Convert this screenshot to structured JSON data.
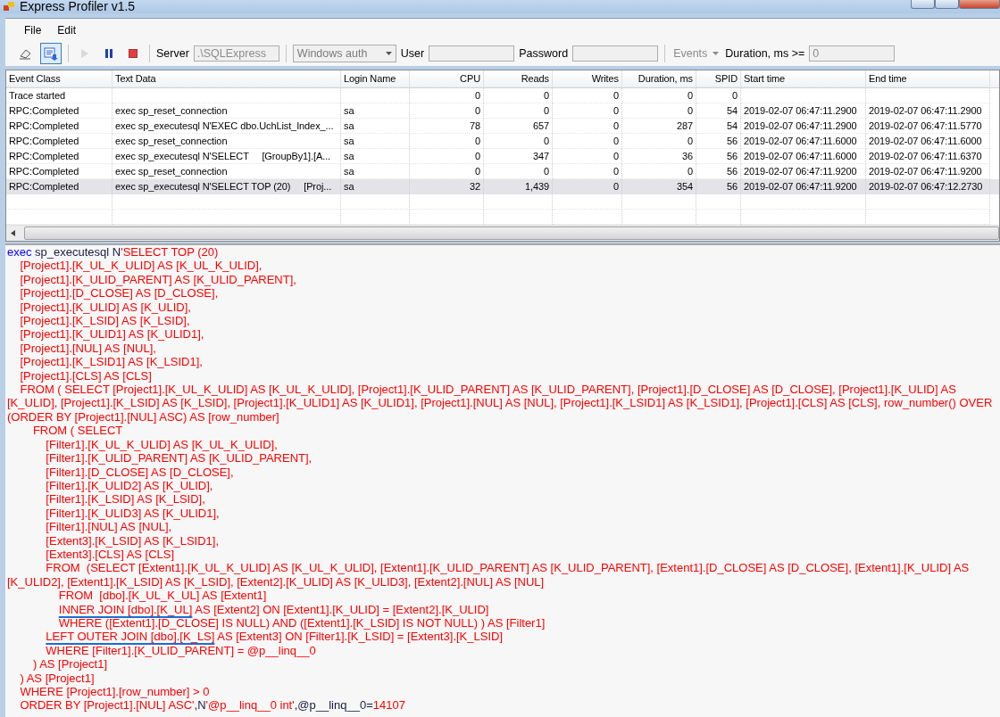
{
  "window": {
    "title": "Express Profiler v1.5"
  },
  "menu": [
    {
      "label": "File"
    },
    {
      "label": "Edit"
    }
  ],
  "toolbar": {
    "buttons": [
      {
        "kind": "clear",
        "pressed": false,
        "disabled": false
      },
      {
        "kind": "autoscroll",
        "pressed": true,
        "disabled": false
      },
      {
        "kind": "start",
        "pressed": false,
        "disabled": true
      },
      {
        "kind": "pause",
        "pressed": false,
        "disabled": false
      },
      {
        "kind": "stop",
        "pressed": false,
        "disabled": false
      }
    ],
    "fields": [
      {
        "kind": "text",
        "label": "Server",
        "value": ".\\SQLExpress",
        "disabled": true
      },
      {
        "kind": "dropdown",
        "value": "Windows auth",
        "disabled": true
      },
      {
        "kind": "text",
        "label": "User",
        "disabled": true
      },
      {
        "kind": "text",
        "label": "Password",
        "disabled": true
      },
      {
        "kind": "menu",
        "value": "Events",
        "disabled": true
      },
      {
        "kind": "text",
        "label": "Duration, ms >=",
        "value": "0",
        "disabled": true
      }
    ]
  },
  "table": {
    "columns": [
      {
        "label": "Event Class",
        "kind": "text"
      },
      {
        "label": "Text Data",
        "kind": "text"
      },
      {
        "label": "Login Name",
        "kind": "text"
      },
      {
        "label": "CPU",
        "kind": "number"
      },
      {
        "label": "Reads",
        "kind": "number"
      },
      {
        "label": "Writes",
        "kind": "number"
      },
      {
        "label": "Duration, ms",
        "kind": "number"
      },
      {
        "label": "SPID",
        "kind": "number"
      },
      {
        "label": "Start time",
        "kind": "text"
      },
      {
        "label": "End time",
        "kind": "text"
      }
    ],
    "rows": [
      {
        "selected": false,
        "cells": [
          "Trace started",
          null,
          null,
          "0",
          "0",
          "0",
          "0",
          "0",
          null,
          null
        ]
      },
      {
        "selected": false,
        "cells": [
          "RPC:Completed",
          "exec sp_reset_connection",
          "sa",
          "0",
          "0",
          "0",
          "0",
          "54",
          "2019-02-07 06:47:11.2900",
          "2019-02-07 06:47:11.2900"
        ]
      },
      {
        "selected": false,
        "cells": [
          "RPC:Completed",
          "exec sp_executesql N'EXEC dbo.UchList_Index_...",
          "sa",
          "78",
          "657",
          "0",
          "287",
          "54",
          "2019-02-07 06:47:11.2900",
          "2019-02-07 06:47:11.5770"
        ]
      },
      {
        "selected": false,
        "cells": [
          "RPC:Completed",
          "exec sp_reset_connection",
          "sa",
          "0",
          "0",
          "0",
          "0",
          "56",
          "2019-02-07 06:47:11.6000",
          "2019-02-07 06:47:11.6000"
        ]
      },
      {
        "selected": false,
        "cells": [
          "RPC:Completed",
          "exec sp_executesql N'SELECT     [GroupBy1].[A...",
          "sa",
          "0",
          "347",
          "0",
          "36",
          "56",
          "2019-02-07 06:47:11.6000",
          "2019-02-07 06:47:11.6370"
        ]
      },
      {
        "selected": false,
        "cells": [
          "RPC:Completed",
          "exec sp_reset_connection",
          "sa",
          "0",
          "0",
          "0",
          "0",
          "56",
          "2019-02-07 06:47:11.9200",
          "2019-02-07 06:47:11.9200"
        ]
      },
      {
        "selected": true,
        "cells": [
          "RPC:Completed",
          "exec sp_executesql N'SELECT TOP (20)     [Proj...",
          "sa",
          "32",
          "1,439",
          "0",
          "354",
          "56",
          "2019-02-07 06:47:11.9200",
          "2019-02-07 06:47:12.2730"
        ]
      }
    ]
  },
  "sql": {
    "lines": [
      [
        {
          "kind": "keyword",
          "text": "exec"
        },
        {
          "kind": "plain",
          "text": " sp_executesql N"
        },
        {
          "kind": "string",
          "text": "'SELECT TOP (20)"
        }
      ],
      [
        {
          "kind": "string",
          "text": "    [Project1].[K_UL_K_ULID] AS [K_UL_K_ULID],"
        }
      ],
      [
        {
          "kind": "string",
          "text": "    [Project1].[K_ULID_PARENT] AS [K_ULID_PARENT],"
        }
      ],
      [
        {
          "kind": "string",
          "text": "    [Project1].[D_CLOSE] AS [D_CLOSE],"
        }
      ],
      [
        {
          "kind": "string",
          "text": "    [Project1].[K_ULID] AS [K_ULID],"
        }
      ],
      [
        {
          "kind": "string",
          "text": "    [Project1].[K_LSID] AS [K_LSID],"
        }
      ],
      [
        {
          "kind": "string",
          "text": "    [Project1].[K_ULID1] AS [K_ULID1],"
        }
      ],
      [
        {
          "kind": "string",
          "text": "    [Project1].[NUL] AS [NUL],"
        }
      ],
      [
        {
          "kind": "string",
          "text": "    [Project1].[K_LSID1] AS [K_LSID1],"
        }
      ],
      [
        {
          "kind": "string",
          "text": "    [Project1].[CLS] AS [CLS]"
        }
      ],
      [
        {
          "kind": "string",
          "text": "    FROM ( SELECT [Project1].[K_UL_K_ULID] AS [K_UL_K_ULID], [Project1].[K_ULID_PARENT] AS [K_ULID_PARENT], [Project1].[D_CLOSE] AS [D_CLOSE], [Project1].[K_ULID] AS"
        }
      ],
      [
        {
          "kind": "string",
          "text": "[K_ULID], [Project1].[K_LSID] AS [K_LSID], [Project1].[K_ULID1] AS [K_ULID1], [Project1].[NUL] AS [NUL], [Project1].[K_LSID1] AS [K_LSID1], [Project1].[CLS] AS [CLS], row_number() OVER"
        }
      ],
      [
        {
          "kind": "string",
          "text": "(ORDER BY [Project1].[NUL] ASC) AS [row_number]"
        }
      ],
      [
        {
          "kind": "string",
          "text": "        FROM ( SELECT"
        }
      ],
      [
        {
          "kind": "string",
          "text": "            [Filter1].[K_UL_K_ULID] AS [K_UL_K_ULID],"
        }
      ],
      [
        {
          "kind": "string",
          "text": "            [Filter1].[K_ULID_PARENT] AS [K_ULID_PARENT],"
        }
      ],
      [
        {
          "kind": "string",
          "text": "            [Filter1].[D_CLOSE] AS [D_CLOSE],"
        }
      ],
      [
        {
          "kind": "string",
          "text": "            [Filter1].[K_ULID2] AS [K_ULID],"
        }
      ],
      [
        {
          "kind": "string",
          "text": "            [Filter1].[K_LSID] AS [K_LSID],"
        }
      ],
      [
        {
          "kind": "string",
          "text": "            [Filter1].[K_ULID3] AS [K_ULID1],"
        }
      ],
      [
        {
          "kind": "string",
          "text": "            [Filter1].[NUL] AS [NUL],"
        }
      ],
      [
        {
          "kind": "string",
          "text": "            [Extent3].[K_LSID] AS [K_LSID1],"
        }
      ],
      [
        {
          "kind": "string",
          "text": "            [Extent3].[CLS] AS [CLS]"
        }
      ],
      [
        {
          "kind": "string",
          "text": "            FROM  (SELECT [Extent1].[K_UL_K_ULID] AS [K_UL_K_ULID], [Extent1].[K_ULID_PARENT] AS [K_ULID_PARENT], [Extent1].[D_CLOSE] AS [D_CLOSE], [Extent1].[K_ULID] AS"
        }
      ],
      [
        {
          "kind": "string",
          "text": "[K_ULID2], [Extent1].[K_LSID] AS [K_LSID], [Extent2].[K_ULID] AS [K_ULID3], [Extent2].[NUL] AS [NUL]"
        }
      ],
      [
        {
          "kind": "string",
          "text": "                FROM  [dbo].[K_UL_K_UL] AS [Extent1]"
        }
      ],
      [
        {
          "kind": "marked",
          "text": "                INNER JOIN [dbo].[K_UL]"
        },
        {
          "kind": "string",
          "text": " AS [Extent2] ON [Extent1].[K_ULID] = [Extent2].[K_ULID]"
        }
      ],
      [
        {
          "kind": "string",
          "text": "                WHERE ([Extent1].[D_CLOSE] IS NULL) AND ([Extent1].[K_LSID] IS NOT NULL) ) AS [Filter1]"
        }
      ],
      [
        {
          "kind": "marked",
          "text": "            LEFT OUTER JOIN [dbo].[K_LS]"
        },
        {
          "kind": "string",
          "text": " AS [Extent3] ON [Filter1].[K_LSID] = [Extent3].[K_LSID]"
        }
      ],
      [
        {
          "kind": "string",
          "text": "            WHERE [Filter1].[K_ULID_PARENT] = @p__linq__0"
        }
      ],
      [
        {
          "kind": "string",
          "text": "        ) AS [Project1]"
        }
      ],
      [
        {
          "kind": "string",
          "text": "    ) AS [Project1]"
        }
      ],
      [
        {
          "kind": "string",
          "text": "    WHERE [Project1].[row_number] > 0"
        }
      ],
      [
        {
          "kind": "string",
          "text": "    ORDER BY [Project1].[NUL] ASC'"
        },
        {
          "kind": "plain",
          "text": ",N"
        },
        {
          "kind": "string",
          "text": "'@p__linq__0 int'"
        },
        {
          "kind": "plain",
          "text": ",@p__linq__0="
        },
        {
          "kind": "string",
          "text": "14107"
        }
      ]
    ]
  }
}
